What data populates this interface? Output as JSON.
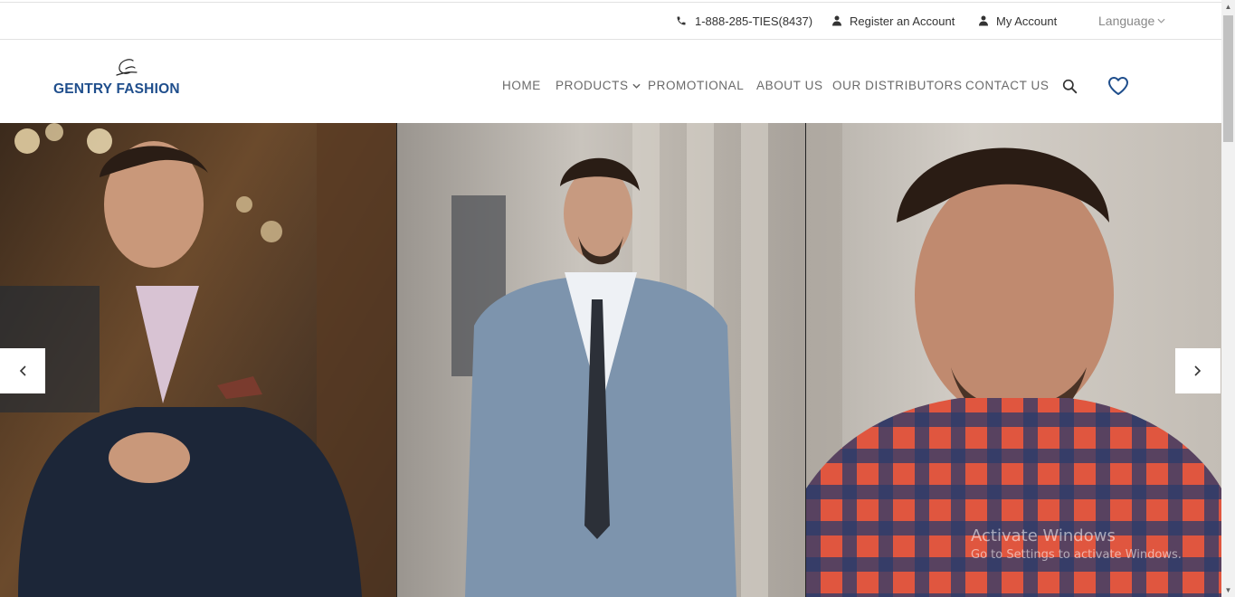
{
  "topbar": {
    "phone": "1-888-285-TIES(8437)",
    "register": "Register an Account",
    "account": "My Account",
    "language": "Language"
  },
  "brand": {
    "name": "GENTRY FASHION",
    "color": "#1f4e8c"
  },
  "nav": {
    "home": "HOME",
    "products": "PRODUCTS",
    "promotional": "PROMOTIONAL",
    "about": "ABOUT US",
    "distributors": "OUR DISTRIBUTORS",
    "contact": "CONTACT US"
  },
  "icons": {
    "phone": "phone-icon",
    "user": "user-icon",
    "search": "search-icon",
    "wishlist": "heart-icon",
    "prev": "chevron-left-icon",
    "next": "chevron-right-icon"
  },
  "watermark": {
    "line1": "Activate Windows",
    "line2": "Go to Settings to activate Windows."
  }
}
